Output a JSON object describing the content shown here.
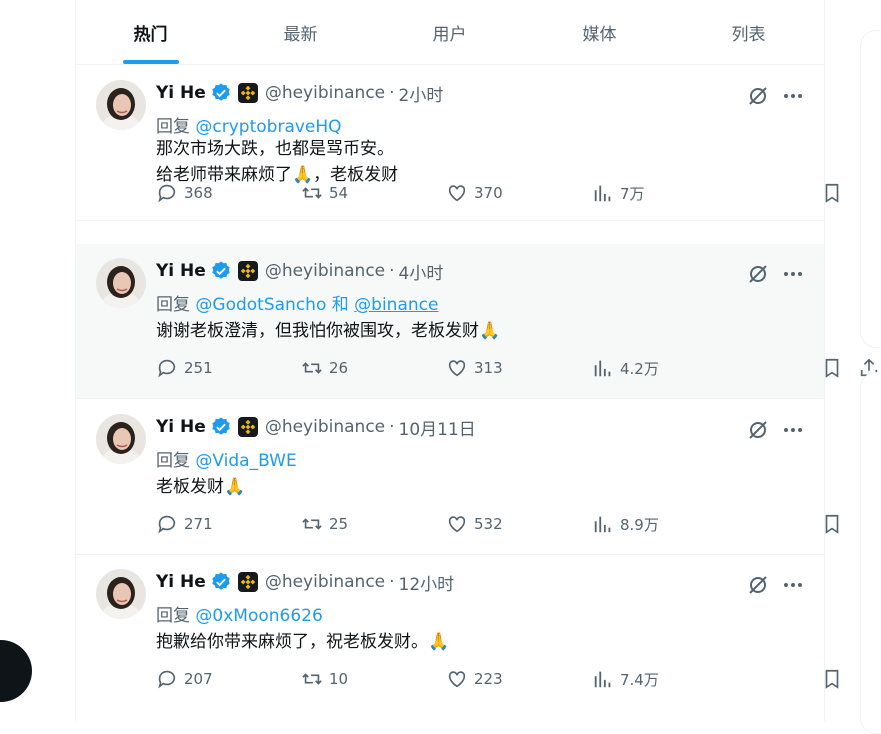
{
  "tabs": [
    {
      "label": "热门",
      "active": true
    },
    {
      "label": "最新",
      "active": false
    },
    {
      "label": "用户",
      "active": false
    },
    {
      "label": "媒体",
      "active": false
    },
    {
      "label": "列表",
      "active": false
    }
  ],
  "colors": {
    "accent": "#1d9bf0",
    "muted": "#536471",
    "text": "#0f1419",
    "highlight_bg": "#f7f9f9"
  },
  "icons": {
    "verified": "verified-badge-icon",
    "affiliate": "binance-logo-icon",
    "grok": "grok-icon",
    "more": "more-icon",
    "reply": "reply-icon",
    "retweet": "retweet-icon",
    "like": "like-icon",
    "views": "views-icon",
    "bookmark": "bookmark-icon",
    "share": "share-icon"
  },
  "tweets": [
    {
      "name": "Yi He",
      "handle": "@heyibinance",
      "sep": "·",
      "time": "2小时",
      "reply_prefix": "回复",
      "reply_to": "@cryptobraveHQ",
      "lines": [
        "那次市场大跌，也都是骂币安。",
        "给老师带来麻烦了🙏，老板发财"
      ],
      "replies": "368",
      "retweets": "54",
      "likes": "370",
      "views": "7万"
    },
    {
      "name": "Yi He",
      "handle": "@heyibinance",
      "sep": "·",
      "time": "4小时",
      "reply_prefix": "回复",
      "reply_to": "@GodotSancho",
      "reply_and": "和",
      "reply_to2": "@binance",
      "lines": [
        "谢谢老板澄清，但我怕你被围攻，老板发财🙏"
      ],
      "replies": "251",
      "retweets": "26",
      "likes": "313",
      "views": "4.2万"
    },
    {
      "name": "Yi He",
      "handle": "@heyibinance",
      "sep": "·",
      "time": "10月11日",
      "reply_prefix": "回复",
      "reply_to": "@Vida_BWE",
      "lines": [
        "老板发财🙏"
      ],
      "replies": "271",
      "retweets": "25",
      "likes": "532",
      "views": "8.9万"
    },
    {
      "name": "Yi He",
      "handle": "@heyibinance",
      "sep": "·",
      "time": "12小时",
      "reply_prefix": "回复",
      "reply_to": "@0xMoon6626",
      "lines": [
        "抱歉给你带来麻烦了，祝老板发财。🙏"
      ],
      "replies": "207",
      "retweets": "10",
      "likes": "223",
      "views": "7.4万"
    }
  ]
}
